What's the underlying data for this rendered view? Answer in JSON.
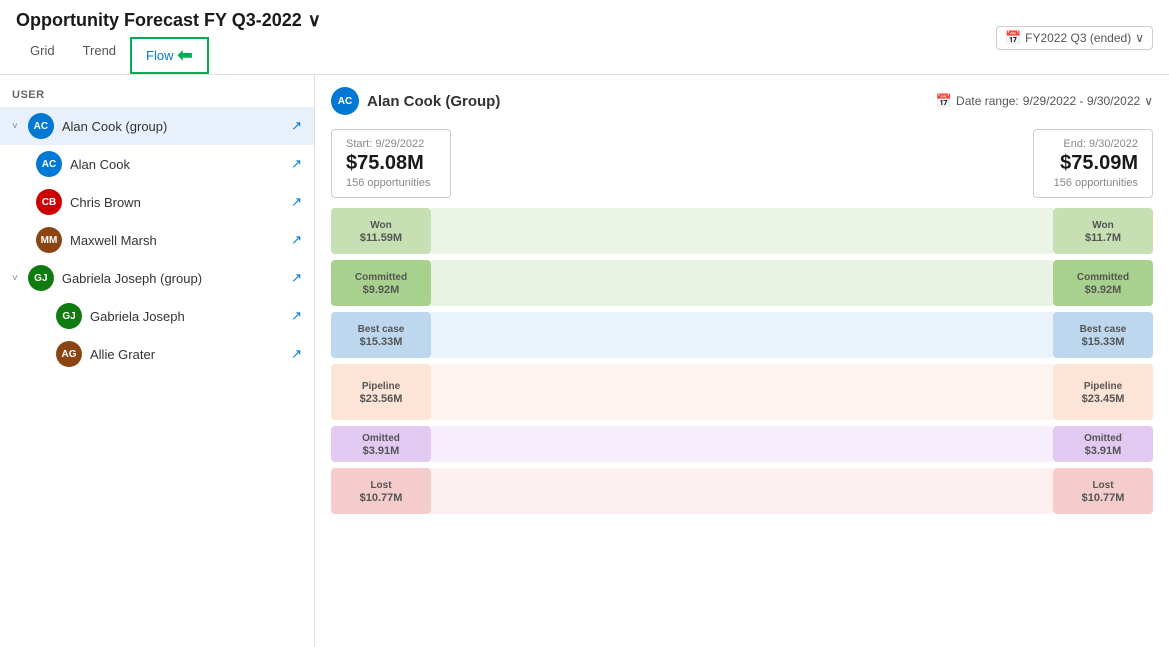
{
  "header": {
    "title": "Opportunity Forecast FY Q3-2022",
    "fy_badge": "FY2022 Q3 (ended)",
    "dropdown_arrow": "∨"
  },
  "nav": {
    "tabs": [
      {
        "id": "grid",
        "label": "Grid",
        "active": false
      },
      {
        "id": "trend",
        "label": "Trend",
        "active": false
      },
      {
        "id": "flow",
        "label": "Flow",
        "active": true,
        "highlighted": true
      }
    ]
  },
  "sidebar": {
    "section_header": "User",
    "users": [
      {
        "id": "alan-cook-group",
        "name": "Alan Cook (group)",
        "initials": "AC",
        "avatar_class": "av-ac",
        "group": true,
        "expanded": true,
        "indent": 0
      },
      {
        "id": "alan-cook",
        "name": "Alan Cook",
        "initials": "AC",
        "avatar_class": "av-ac",
        "group": false,
        "indent": 1
      },
      {
        "id": "chris-brown",
        "name": "Chris Brown",
        "initials": "CB",
        "avatar_class": "av-cb",
        "group": false,
        "indent": 1
      },
      {
        "id": "maxwell-marsh",
        "name": "Maxwell Marsh",
        "initials": "MM",
        "avatar_class": "av-mm",
        "group": false,
        "indent": 1
      },
      {
        "id": "gabriela-joseph-group",
        "name": "Gabriela Joseph (group)",
        "initials": "GJ",
        "avatar_class": "av-gj",
        "group": true,
        "expanded": true,
        "indent": 0
      },
      {
        "id": "gabriela-joseph",
        "name": "Gabriela Joseph",
        "initials": "GJ",
        "avatar_class": "av-gj",
        "group": false,
        "indent": 2
      },
      {
        "id": "allie-grater",
        "name": "Allie Grater",
        "initials": "AG",
        "avatar_class": "av-ag",
        "group": false,
        "indent": 2
      }
    ]
  },
  "main": {
    "user_label": "Alan Cook (Group)",
    "user_initials": "AC",
    "date_range_label": "Date range:",
    "date_range": "9/29/2022 - 9/30/2022",
    "start": {
      "label": "Start: 9/29/2022",
      "amount": "$75.08M",
      "opps": "156 opportunities"
    },
    "end": {
      "label": "End: 9/30/2022",
      "amount": "$75.09M",
      "opps": "156 opportunities"
    },
    "flow_rows": [
      {
        "id": "won",
        "label": "Won",
        "amount_left": "$11.59M",
        "amount_right": "$11.7M",
        "color_class": "won-color",
        "mid_class": "won-mid"
      },
      {
        "id": "committed",
        "label": "Committed",
        "amount_left": "$9.92M",
        "amount_right": "$9.92M",
        "color_class": "committed-color",
        "mid_class": "committed-mid"
      },
      {
        "id": "bestcase",
        "label": "Best case",
        "amount_left": "$15.33M",
        "amount_right": "$15.33M",
        "color_class": "bestcase-color",
        "mid_class": "bestcase-mid"
      },
      {
        "id": "pipeline",
        "label": "Pipeline",
        "amount_left": "$23.56M",
        "amount_right": "$23.45M",
        "color_class": "pipeline-color",
        "mid_class": "pipeline-mid"
      },
      {
        "id": "omitted",
        "label": "Omitted",
        "amount_left": "$3.91M",
        "amount_right": "$3.91M",
        "color_class": "omitted-color",
        "mid_class": "omitted-mid"
      },
      {
        "id": "lost",
        "label": "Lost",
        "amount_left": "$10.77M",
        "amount_right": "$10.77M",
        "color_class": "lost-color",
        "mid_class": "lost-mid"
      }
    ]
  },
  "icons": {
    "calendar": "📅",
    "share": "↗",
    "chevron_down": "∨",
    "chevron_right": "›",
    "expand_down": "˅",
    "arrow_left": "←"
  }
}
